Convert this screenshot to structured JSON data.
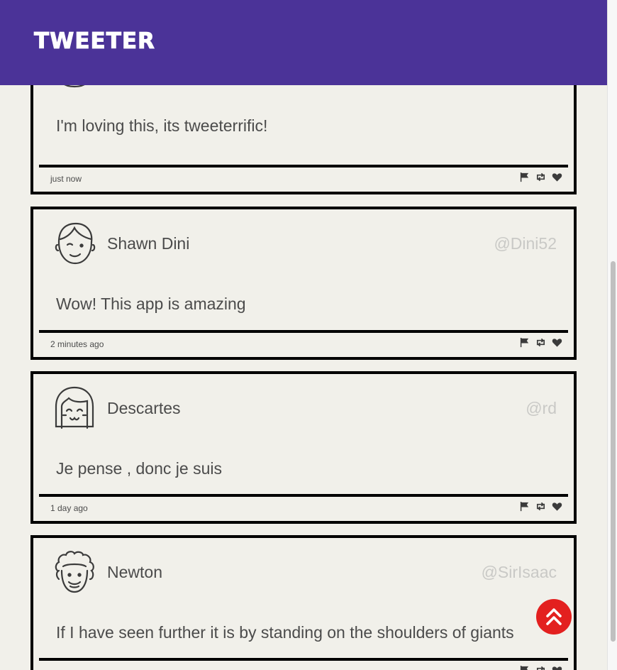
{
  "app": {
    "brand": "TWEETER"
  },
  "colors": {
    "header_bg": "#4b3398",
    "page_bg": "#f1f0ea",
    "border": "#000000",
    "handle": "#c9c9c6",
    "back_to_top": "#e3201f"
  },
  "tweets": [
    {
      "name": "",
      "handle": "@",
      "text": "I'm loving this, its tweeterrific!",
      "time": "just now",
      "avatar_icon": "grinning-face-icon"
    },
    {
      "name": "Shawn Dini",
      "handle": "@Dini52",
      "text": "Wow! This app is amazing",
      "time": "2 minutes ago",
      "avatar_icon": "winking-man-icon"
    },
    {
      "name": "Descartes",
      "handle": "@rd",
      "text": "Je pense , donc je suis",
      "time": "1 day ago",
      "avatar_icon": "bob-hair-woman-icon"
    },
    {
      "name": "Newton",
      "handle": "@SirIsaac",
      "text": "If I have seen further it is by standing on the shoulders of giants",
      "time": "",
      "avatar_icon": "curly-hair-man-icon"
    }
  ],
  "actions": [
    "flag-icon",
    "retweet-icon",
    "heart-icon"
  ],
  "back_to_top_icon": "double-chevron-up-icon"
}
